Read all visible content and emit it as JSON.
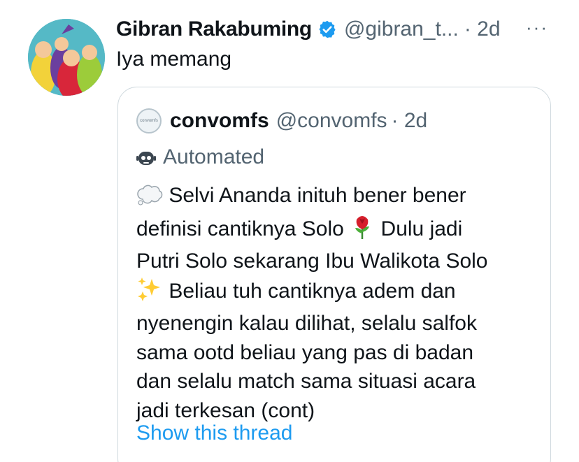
{
  "tweet": {
    "author_name": "Gibran Rakabuming",
    "author_handle": "@gibran_t...",
    "time": "· 2d",
    "more_label": "···",
    "text": "Iya memang"
  },
  "quoted": {
    "author_name": "convomfs",
    "author_handle": "@convomfs",
    "time": "· 2d",
    "avatar_text": "convomfs",
    "automated_label": "Automated",
    "body": {
      "line1": "Selvi Ananda inituh bener bener",
      "line2a": "definisi cantiknya Solo",
      "line2b": "Dulu jadi",
      "line3": "Putri Solo sekarang Ibu Walikota Solo",
      "line4": "Beliau tuh cantiknya adem dan",
      "line5": "nyenengin kalau dilihat, selalu salfok",
      "line6": "sama ootd beliau yang pas di badan",
      "line7": "dan selalu match sama situasi acara",
      "line8": "jadi terkesan (cont)"
    },
    "show_thread_label": "Show this thread"
  },
  "colors": {
    "text": "#0f1419",
    "secondary": "#536471",
    "link": "#1d9bf0",
    "border": "#cfd9de",
    "verified": "#1d9bf0"
  },
  "icons": [
    "avatar",
    "verified-badge-icon",
    "more-options-icon",
    "bot-icon",
    "thought-balloon-icon",
    "rose-icon",
    "sparkles-icon"
  ]
}
